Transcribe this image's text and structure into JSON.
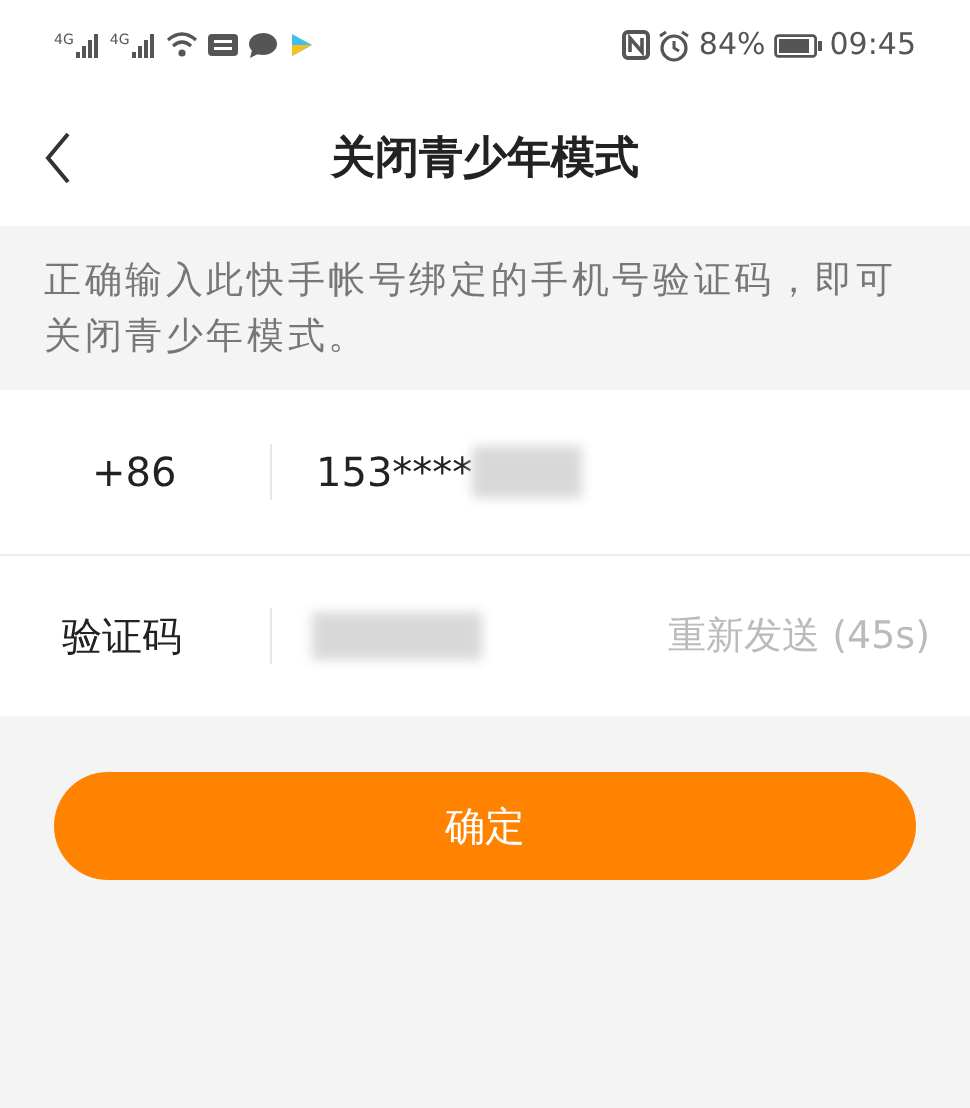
{
  "status_bar": {
    "signal_1": "4G",
    "signal_2": "4G",
    "battery_percent": "84%",
    "time": "09:45"
  },
  "header": {
    "title": "关闭青少年模式"
  },
  "notice": "正确输入此快手帐号绑定的手机号验证码，即可关闭青少年模式。",
  "phone_row": {
    "country_code": "+86",
    "phone_visible": "153****"
  },
  "code_row": {
    "label": "验证码",
    "resend": {
      "label": "重新发送 (45s)",
      "disabled": true
    }
  },
  "confirm_button": {
    "label": "确定"
  }
}
